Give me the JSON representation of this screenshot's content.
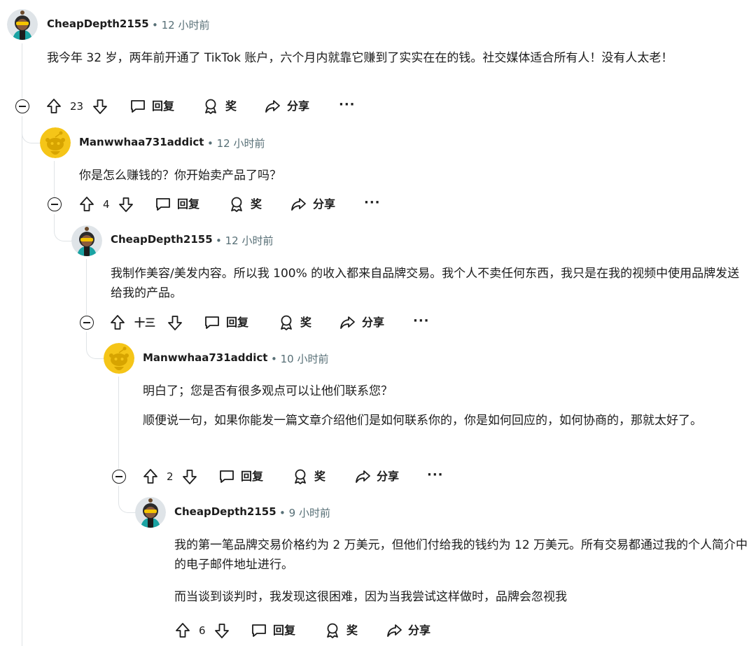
{
  "comments": [
    {
      "username": "CheapDepth2155",
      "time": "12 小时前",
      "avatar": "cheap-avatar",
      "body": [
        "我今年 32 岁，两年前开通了 TikTok 账户，六个月内就靠它赚到了实实在在的钱。社交媒体适合所有人！没有人太老！"
      ],
      "votes": "23",
      "reply_label": "回复",
      "award_label": "奖",
      "share_label": "分享"
    },
    {
      "username": "Manwwhaa731addict",
      "time": "12 小时前",
      "avatar": "snoo-avatar",
      "body": [
        "你是怎么赚钱的？你开始卖产品了吗？"
      ],
      "votes": "4",
      "reply_label": "回复",
      "award_label": "奖",
      "share_label": "分享"
    },
    {
      "username": "CheapDepth2155",
      "time": "12 小时前",
      "avatar": "cheap-avatar",
      "body": [
        "我制作美容/美发内容。所以我 100% 的收入都来自品牌交易。我个人不卖任何东西，我只是在我的视频中使用品牌发送给我的产品。"
      ],
      "votes": "十三",
      "reply_label": "回复",
      "award_label": "奖",
      "share_label": "分享"
    },
    {
      "username": "Manwwhaa731addict",
      "time": "10 小时前",
      "avatar": "snoo-avatar",
      "body": [
        "明白了；您是否有很多观点可以让他们联系您？",
        "顺便说一句，如果你能发一篇文章介绍他们是如何联系你的，你是如何回应的，如何协商的，那就太好了。"
      ],
      "votes": "2",
      "reply_label": "回复",
      "award_label": "奖",
      "share_label": "分享"
    },
    {
      "username": "CheapDepth2155",
      "time": "9 小时前",
      "avatar": "cheap-avatar",
      "body": [
        "我的第一笔品牌交易价格约为 2 万美元，但他们付给我的钱约为 12 万美元。所有交易都通过我的个人简介中的电子邮件地址进行。",
        "而当谈到谈判时，我发现这很困难，因为当我尝试这样做时，品牌会忽视我"
      ],
      "votes": "6",
      "reply_label": "回复",
      "award_label": "奖",
      "share_label": "分享"
    }
  ],
  "separator": "•",
  "more_label": "···"
}
